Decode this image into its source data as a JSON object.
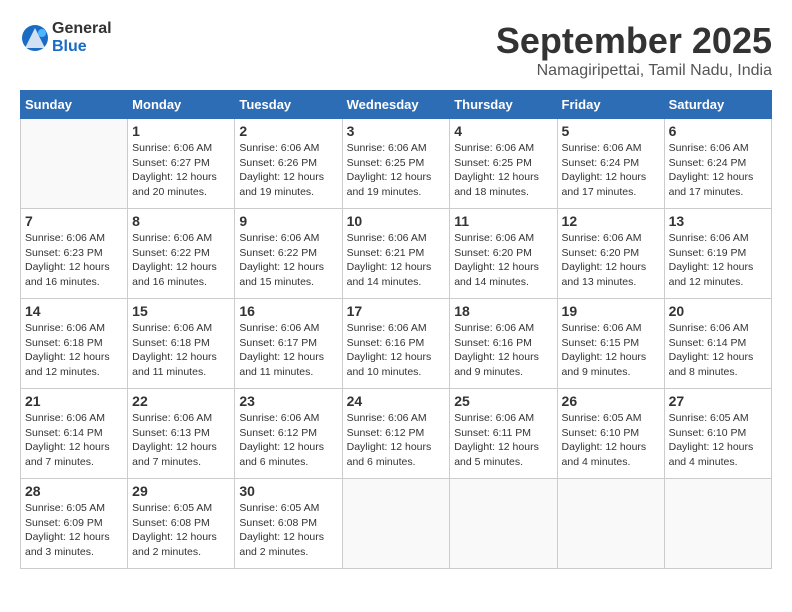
{
  "header": {
    "logo_general": "General",
    "logo_blue": "Blue",
    "month_year": "September 2025",
    "location": "Namagiripettai, Tamil Nadu, India"
  },
  "days_of_week": [
    "Sunday",
    "Monday",
    "Tuesday",
    "Wednesday",
    "Thursday",
    "Friday",
    "Saturday"
  ],
  "weeks": [
    [
      {
        "day": "",
        "info": ""
      },
      {
        "day": "1",
        "info": "Sunrise: 6:06 AM\nSunset: 6:27 PM\nDaylight: 12 hours\nand 20 minutes."
      },
      {
        "day": "2",
        "info": "Sunrise: 6:06 AM\nSunset: 6:26 PM\nDaylight: 12 hours\nand 19 minutes."
      },
      {
        "day": "3",
        "info": "Sunrise: 6:06 AM\nSunset: 6:25 PM\nDaylight: 12 hours\nand 19 minutes."
      },
      {
        "day": "4",
        "info": "Sunrise: 6:06 AM\nSunset: 6:25 PM\nDaylight: 12 hours\nand 18 minutes."
      },
      {
        "day": "5",
        "info": "Sunrise: 6:06 AM\nSunset: 6:24 PM\nDaylight: 12 hours\nand 17 minutes."
      },
      {
        "day": "6",
        "info": "Sunrise: 6:06 AM\nSunset: 6:24 PM\nDaylight: 12 hours\nand 17 minutes."
      }
    ],
    [
      {
        "day": "7",
        "info": "Sunrise: 6:06 AM\nSunset: 6:23 PM\nDaylight: 12 hours\nand 16 minutes."
      },
      {
        "day": "8",
        "info": "Sunrise: 6:06 AM\nSunset: 6:22 PM\nDaylight: 12 hours\nand 16 minutes."
      },
      {
        "day": "9",
        "info": "Sunrise: 6:06 AM\nSunset: 6:22 PM\nDaylight: 12 hours\nand 15 minutes."
      },
      {
        "day": "10",
        "info": "Sunrise: 6:06 AM\nSunset: 6:21 PM\nDaylight: 12 hours\nand 14 minutes."
      },
      {
        "day": "11",
        "info": "Sunrise: 6:06 AM\nSunset: 6:20 PM\nDaylight: 12 hours\nand 14 minutes."
      },
      {
        "day": "12",
        "info": "Sunrise: 6:06 AM\nSunset: 6:20 PM\nDaylight: 12 hours\nand 13 minutes."
      },
      {
        "day": "13",
        "info": "Sunrise: 6:06 AM\nSunset: 6:19 PM\nDaylight: 12 hours\nand 12 minutes."
      }
    ],
    [
      {
        "day": "14",
        "info": "Sunrise: 6:06 AM\nSunset: 6:18 PM\nDaylight: 12 hours\nand 12 minutes."
      },
      {
        "day": "15",
        "info": "Sunrise: 6:06 AM\nSunset: 6:18 PM\nDaylight: 12 hours\nand 11 minutes."
      },
      {
        "day": "16",
        "info": "Sunrise: 6:06 AM\nSunset: 6:17 PM\nDaylight: 12 hours\nand 11 minutes."
      },
      {
        "day": "17",
        "info": "Sunrise: 6:06 AM\nSunset: 6:16 PM\nDaylight: 12 hours\nand 10 minutes."
      },
      {
        "day": "18",
        "info": "Sunrise: 6:06 AM\nSunset: 6:16 PM\nDaylight: 12 hours\nand 9 minutes."
      },
      {
        "day": "19",
        "info": "Sunrise: 6:06 AM\nSunset: 6:15 PM\nDaylight: 12 hours\nand 9 minutes."
      },
      {
        "day": "20",
        "info": "Sunrise: 6:06 AM\nSunset: 6:14 PM\nDaylight: 12 hours\nand 8 minutes."
      }
    ],
    [
      {
        "day": "21",
        "info": "Sunrise: 6:06 AM\nSunset: 6:14 PM\nDaylight: 12 hours\nand 7 minutes."
      },
      {
        "day": "22",
        "info": "Sunrise: 6:06 AM\nSunset: 6:13 PM\nDaylight: 12 hours\nand 7 minutes."
      },
      {
        "day": "23",
        "info": "Sunrise: 6:06 AM\nSunset: 6:12 PM\nDaylight: 12 hours\nand 6 minutes."
      },
      {
        "day": "24",
        "info": "Sunrise: 6:06 AM\nSunset: 6:12 PM\nDaylight: 12 hours\nand 6 minutes."
      },
      {
        "day": "25",
        "info": "Sunrise: 6:06 AM\nSunset: 6:11 PM\nDaylight: 12 hours\nand 5 minutes."
      },
      {
        "day": "26",
        "info": "Sunrise: 6:05 AM\nSunset: 6:10 PM\nDaylight: 12 hours\nand 4 minutes."
      },
      {
        "day": "27",
        "info": "Sunrise: 6:05 AM\nSunset: 6:10 PM\nDaylight: 12 hours\nand 4 minutes."
      }
    ],
    [
      {
        "day": "28",
        "info": "Sunrise: 6:05 AM\nSunset: 6:09 PM\nDaylight: 12 hours\nand 3 minutes."
      },
      {
        "day": "29",
        "info": "Sunrise: 6:05 AM\nSunset: 6:08 PM\nDaylight: 12 hours\nand 2 minutes."
      },
      {
        "day": "30",
        "info": "Sunrise: 6:05 AM\nSunset: 6:08 PM\nDaylight: 12 hours\nand 2 minutes."
      },
      {
        "day": "",
        "info": ""
      },
      {
        "day": "",
        "info": ""
      },
      {
        "day": "",
        "info": ""
      },
      {
        "day": "",
        "info": ""
      }
    ]
  ]
}
